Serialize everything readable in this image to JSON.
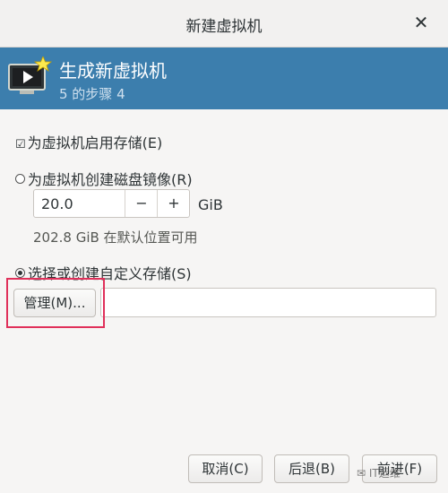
{
  "window": {
    "title": "新建虚拟机",
    "close_glyph": "✕"
  },
  "banner": {
    "icon": "vm-monitor-icon",
    "title": "生成新虚拟机",
    "step": "5 的步骤 4"
  },
  "storage": {
    "enable_label": "为虚拟机启用存储(E)",
    "enable_checked": true,
    "create_image_label": "为虚拟机创建磁盘镜像(R)",
    "size_value": "20.0",
    "minus": "−",
    "plus": "+",
    "unit": "GiB",
    "available": "202.8 GiB 在默认位置可用",
    "custom_label": "选择或创建自定义存储(S)",
    "selected": "custom",
    "manage_button": "管理(M)...",
    "path_value": ""
  },
  "footer": {
    "cancel": "取消(C)",
    "back": "后退(B)",
    "forward": "前进(F)"
  },
  "watermark": "IT运维"
}
